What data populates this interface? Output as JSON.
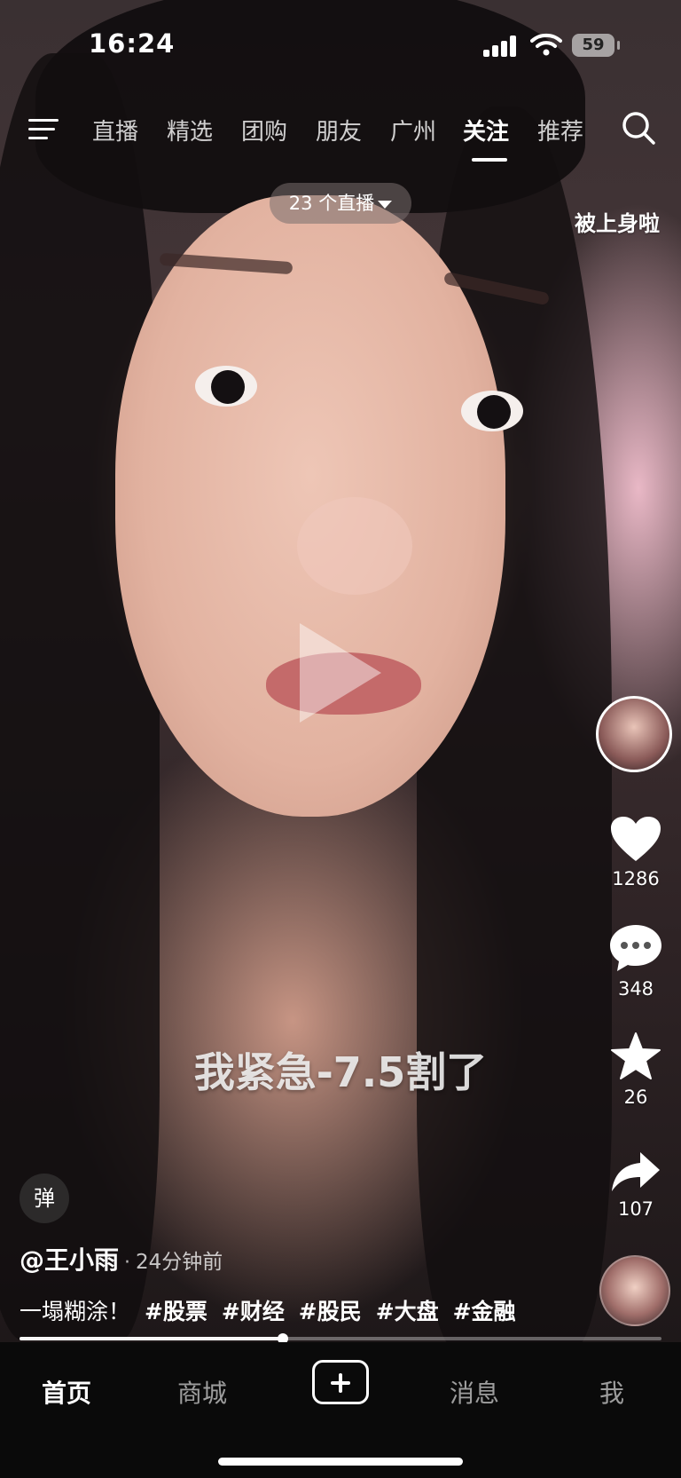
{
  "status_bar": {
    "time": "16:24",
    "battery": "59"
  },
  "top_nav": {
    "tabs": [
      "直播",
      "精选",
      "团购",
      "朋友",
      "广州",
      "关注",
      "推荐"
    ],
    "active_tab": "关注",
    "icons": {
      "menu": "menu-icon",
      "search": "search-icon"
    }
  },
  "live_pill": {
    "label": "23 个直播"
  },
  "side_label": "被上身啦",
  "video": {
    "caption": "我紧急-7.5割了",
    "progress": 0.41
  },
  "actions": {
    "likes": "1286",
    "comments": "348",
    "favorites": "26",
    "shares": "107"
  },
  "post": {
    "danmu_label": "弹",
    "author": "@王小雨",
    "separator": "·",
    "time_ago": "24分钟前",
    "description": "一塌糊涂！",
    "hashtags": [
      "#股票",
      "#财经",
      "#股民",
      "#大盘",
      "#金融"
    ]
  },
  "bottom_nav": {
    "home": "首页",
    "mall": "商城",
    "messages": "消息",
    "me": "我",
    "active": "首页"
  },
  "colors": {
    "background": "#000000",
    "bottom_bar": "#0a0a0a",
    "text": "#ffffff"
  }
}
